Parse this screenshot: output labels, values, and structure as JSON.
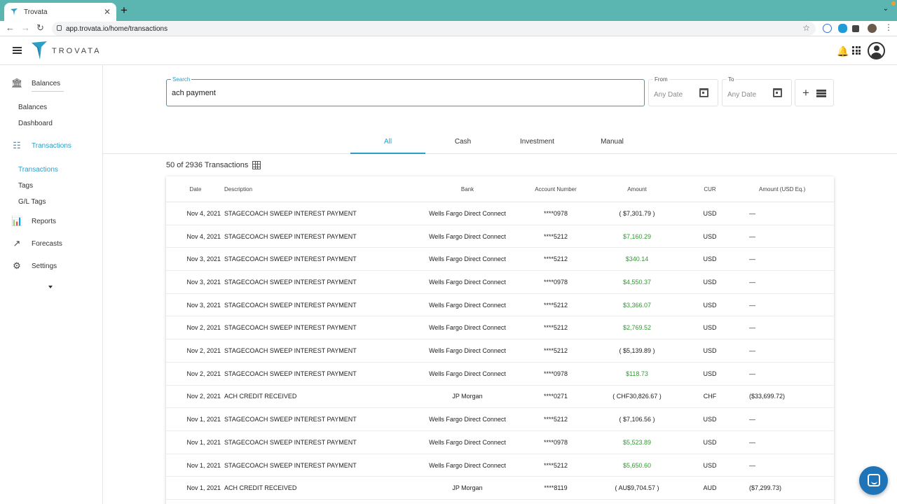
{
  "browser": {
    "tab_title": "Trovata",
    "url": "app.trovata.io/home/transactions"
  },
  "header": {
    "brand": "TROVATA"
  },
  "sidebar": {
    "sections": [
      {
        "label": "Balances",
        "icon": "bank-icon"
      },
      {
        "label": "Transactions",
        "icon": "list-icon",
        "active": true
      },
      {
        "label": "Reports",
        "icon": "reports-icon"
      },
      {
        "label": "Forecasts",
        "icon": "trending-up-icon"
      },
      {
        "label": "Settings",
        "icon": "gear-icon"
      }
    ],
    "balances_sub": [
      "Balances",
      "Dashboard"
    ],
    "transactions_sub": [
      "Transactions",
      "Tags",
      "G/L Tags"
    ]
  },
  "search": {
    "label": "Search",
    "value": "ach payment"
  },
  "from": {
    "label": "From",
    "value": "Any Date"
  },
  "to": {
    "label": "To",
    "value": "Any Date"
  },
  "tabs": [
    "All",
    "Cash",
    "Investment",
    "Manual"
  ],
  "count_text": "50 of 2936 Transactions",
  "table": {
    "headers": [
      "Date",
      "Description",
      "Bank",
      "Account Number",
      "Amount",
      "CUR",
      "Amount (USD Eq.)"
    ],
    "rows": [
      {
        "date": "Nov 4, 2021",
        "desc": "STAGECOACH SWEEP INTEREST PAYMENT",
        "bank": "Wells Fargo Direct Connect",
        "acct": "****0978",
        "amt": "( $7,301.79 )",
        "cur": "USD",
        "usd": "—",
        "positive": false
      },
      {
        "date": "Nov 4, 2021",
        "desc": "STAGECOACH SWEEP INTEREST PAYMENT",
        "bank": "Wells Fargo Direct Connect",
        "acct": "****5212",
        "amt": "$7,160.29",
        "cur": "USD",
        "usd": "—",
        "positive": true
      },
      {
        "date": "Nov 3, 2021",
        "desc": "STAGECOACH SWEEP INTEREST PAYMENT",
        "bank": "Wells Fargo Direct Connect",
        "acct": "****5212",
        "amt": "$340.14",
        "cur": "USD",
        "usd": "—",
        "positive": true
      },
      {
        "date": "Nov 3, 2021",
        "desc": "STAGECOACH SWEEP INTEREST PAYMENT",
        "bank": "Wells Fargo Direct Connect",
        "acct": "****0978",
        "amt": "$4,550.37",
        "cur": "USD",
        "usd": "—",
        "positive": true
      },
      {
        "date": "Nov 3, 2021",
        "desc": "STAGECOACH SWEEP INTEREST PAYMENT",
        "bank": "Wells Fargo Direct Connect",
        "acct": "****5212",
        "amt": "$3,366.07",
        "cur": "USD",
        "usd": "—",
        "positive": true
      },
      {
        "date": "Nov 2, 2021",
        "desc": "STAGECOACH SWEEP INTEREST PAYMENT",
        "bank": "Wells Fargo Direct Connect",
        "acct": "****5212",
        "amt": "$2,769.52",
        "cur": "USD",
        "usd": "—",
        "positive": true
      },
      {
        "date": "Nov 2, 2021",
        "desc": "STAGECOACH SWEEP INTEREST PAYMENT",
        "bank": "Wells Fargo Direct Connect",
        "acct": "****5212",
        "amt": "( $5,139.89 )",
        "cur": "USD",
        "usd": "—",
        "positive": false
      },
      {
        "date": "Nov 2, 2021",
        "desc": "STAGECOACH SWEEP INTEREST PAYMENT",
        "bank": "Wells Fargo Direct Connect",
        "acct": "****0978",
        "amt": "$118.73",
        "cur": "USD",
        "usd": "—",
        "positive": true
      },
      {
        "date": "Nov 2, 2021",
        "desc": "ACH CREDIT RECEIVED",
        "bank": "JP Morgan",
        "acct": "****0271",
        "amt": "( CHF30,826.67 )",
        "cur": "CHF",
        "usd": "($33,699.72)",
        "positive": false
      },
      {
        "date": "Nov 1, 2021",
        "desc": "STAGECOACH SWEEP INTEREST PAYMENT",
        "bank": "Wells Fargo Direct Connect",
        "acct": "****5212",
        "amt": "( $7,106.56 )",
        "cur": "USD",
        "usd": "—",
        "positive": false
      },
      {
        "date": "Nov 1, 2021",
        "desc": "STAGECOACH SWEEP INTEREST PAYMENT",
        "bank": "Wells Fargo Direct Connect",
        "acct": "****0978",
        "amt": "$5,523.89",
        "cur": "USD",
        "usd": "—",
        "positive": true
      },
      {
        "date": "Nov 1, 2021",
        "desc": "STAGECOACH SWEEP INTEREST PAYMENT",
        "bank": "Wells Fargo Direct Connect",
        "acct": "****5212",
        "amt": "$5,650.60",
        "cur": "USD",
        "usd": "—",
        "positive": true
      },
      {
        "date": "Nov 1, 2021",
        "desc": "ACH CREDIT RECEIVED",
        "bank": "JP Morgan",
        "acct": "****8119",
        "amt": "( AU$9,704.57 )",
        "cur": "AUD",
        "usd": "($7,299.73)",
        "positive": false
      }
    ]
  },
  "colors": {
    "accent": "#2b9fc7",
    "positive": "#2e9b2e",
    "tabstrip": "#5bb5b0",
    "chat_fab": "#1f73b7"
  }
}
